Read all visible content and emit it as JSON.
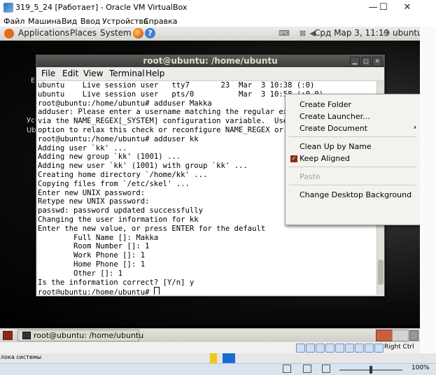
{
  "vbox": {
    "title": "319_5_24 [Работает] - Oracle VM VirtualBox",
    "menu": [
      "Файл",
      "Машина",
      "Вид",
      "Ввод",
      "Устройства",
      "Справка"
    ],
    "controls": {
      "minimize": "—",
      "maximize": "☐",
      "close": "✕"
    },
    "status_label": "Right Ctrl"
  },
  "gnome_panel": {
    "applications": "Applications",
    "places": "Places",
    "system": "System",
    "help_glyph": "?",
    "clock": "Срд Мар 3, 11:19",
    "user": "ubuntu"
  },
  "desktop": {
    "partial_labels": [
      "E",
      "Уст",
      "Ub"
    ]
  },
  "terminal": {
    "title": "root@ubuntu: /home/ubuntu",
    "menu": {
      "file": "File",
      "edit": "Edit",
      "view": "View",
      "terminal": "Terminal",
      "help": "Help"
    },
    "lines": [
      "ubuntu    Live session user   tty7       23  Mar  3 10:38 (:0)",
      "ubuntu    Live session user   pts/0          Mar  3 10:58 (:0.0)",
      "root@ubuntu:/home/ubuntu# adduser Makka",
      "adduser: Please enter a username matching the regular expression configured",
      "via the NAME_REGEX[_SYSTEM] configuration variable.  Use the `--force-badname'",
      "option to relax this check or reconfigure NAME_REGEX or NAME_REGEX_SYSTEM.",
      "root@ubuntu:/home/ubuntu# adduser kk",
      "Adding user `kk' ...",
      "Adding new group `kk' (1001) ...",
      "Adding new user `kk' (1001) with group `kk' ...",
      "Creating home directory `/home/kk' ...",
      "Copying files from `/etc/skel' ...",
      "Enter new UNIX password:",
      "Retype new UNIX password:",
      "passwd: password updated successfully",
      "Changing the user information for kk",
      "Enter the new value, or press ENTER for the default",
      "        Full Name []: Makka",
      "        Room Number []: 1",
      "        Work Phone []: 1",
      "        Home Phone []: 1",
      "        Other []: 1",
      "Is the information correct? [Y/n] y"
    ],
    "prompt": "root@ubuntu:/home/ubuntu# "
  },
  "context_menu": {
    "create_folder": "Create Folder",
    "create_launcher": "Create Launcher...",
    "create_document": "Create Document",
    "clean_up": "Clean Up by Name",
    "keep_aligned": "Keep Aligned",
    "paste": "Paste",
    "change_background": "Change Desktop Background",
    "submenu_arrow": "›",
    "check_glyph": "✓"
  },
  "bottom_panel": {
    "task_terminal": "root@ubuntu: /home/ubuntu"
  },
  "host": {
    "status_text": "лока системы",
    "zoom": "100%"
  },
  "colors": {
    "ubuntu_orange": "#e06a1d",
    "terminal_title_bg": "#3c3b37",
    "desktop_bg": "#000000"
  }
}
